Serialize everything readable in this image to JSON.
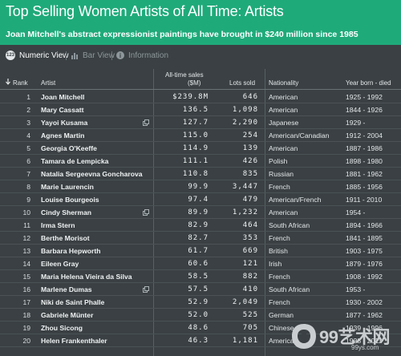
{
  "header": {
    "title": "Top Selling Women Artists of All Time: Artists",
    "subtitle": "Joan Mitchell's abstract expressionist paintings have brought in $240 million since 1985",
    "background_color": "#1faa7a"
  },
  "view_tabs": [
    {
      "label": "Numeric View",
      "icon": "numeric-view-icon",
      "active": true
    },
    {
      "label": "Bar View",
      "icon": "bar-chart-icon",
      "active": false
    },
    {
      "label": "Information",
      "icon": "info-icon",
      "active": false
    }
  ],
  "table": {
    "sort_icon": "sort-down-arrow-icon",
    "columns": {
      "rank": "Rank",
      "artist": "Artist",
      "sales_line1": "All-time sales",
      "sales_line2": "($M)",
      "lots": "Lots sold",
      "nationality": "Nationality",
      "years": "Year born - died"
    },
    "rows": [
      {
        "rank": "1",
        "artist": "Joan Mitchell",
        "sales": "$239.8M",
        "lots": "646",
        "nationality": "American",
        "years": "1925 - 1992",
        "link_icon": false
      },
      {
        "rank": "2",
        "artist": "Mary Cassatt",
        "sales": "136.5",
        "lots": "1,098",
        "nationality": "American",
        "years": "1844 - 1926",
        "link_icon": false
      },
      {
        "rank": "3",
        "artist": "Yayoi Kusama",
        "sales": "127.7",
        "lots": "2,290",
        "nationality": "Japanese",
        "years": "1929 -",
        "link_icon": true
      },
      {
        "rank": "4",
        "artist": "Agnes Martin",
        "sales": "115.0",
        "lots": "254",
        "nationality": "American/Canadian",
        "years": "1912 - 2004",
        "link_icon": false
      },
      {
        "rank": "5",
        "artist": "Georgia O'Keeffe",
        "sales": "114.9",
        "lots": "139",
        "nationality": "American",
        "years": "1887 - 1986",
        "link_icon": false
      },
      {
        "rank": "6",
        "artist": "Tamara de Lempicka",
        "sales": "111.1",
        "lots": "426",
        "nationality": "Polish",
        "years": "1898 - 1980",
        "link_icon": false
      },
      {
        "rank": "7",
        "artist": "Natalia Sergeevna Goncharova",
        "sales": "110.8",
        "lots": "835",
        "nationality": "Russian",
        "years": "1881 - 1962",
        "link_icon": false
      },
      {
        "rank": "8",
        "artist": "Marie Laurencin",
        "sales": "99.9",
        "lots": "3,447",
        "nationality": "French",
        "years": "1885 - 1956",
        "link_icon": false
      },
      {
        "rank": "9",
        "artist": "Louise Bourgeois",
        "sales": "97.4",
        "lots": "479",
        "nationality": "American/French",
        "years": "1911 - 2010",
        "link_icon": false
      },
      {
        "rank": "10",
        "artist": "Cindy Sherman",
        "sales": "89.9",
        "lots": "1,232",
        "nationality": "American",
        "years": "1954 -",
        "link_icon": true
      },
      {
        "rank": "11",
        "artist": "Irma Stern",
        "sales": "82.9",
        "lots": "464",
        "nationality": "South African",
        "years": "1894 - 1966",
        "link_icon": false
      },
      {
        "rank": "12",
        "artist": "Berthe Morisot",
        "sales": "82.7",
        "lots": "353",
        "nationality": "French",
        "years": "1841 - 1895",
        "link_icon": false
      },
      {
        "rank": "13",
        "artist": "Barbara Hepworth",
        "sales": "61.7",
        "lots": "669",
        "nationality": "British",
        "years": "1903 - 1975",
        "link_icon": false
      },
      {
        "rank": "14",
        "artist": "Eileen Gray",
        "sales": "60.6",
        "lots": "121",
        "nationality": "Irish",
        "years": "1879 - 1976",
        "link_icon": false
      },
      {
        "rank": "15",
        "artist": "Maria Helena Vieira da Silva",
        "sales": "58.5",
        "lots": "882",
        "nationality": "French",
        "years": "1908 - 1992",
        "link_icon": false
      },
      {
        "rank": "16",
        "artist": "Marlene Dumas",
        "sales": "57.5",
        "lots": "410",
        "nationality": "South African",
        "years": "1953 -",
        "link_icon": true
      },
      {
        "rank": "17",
        "artist": "Niki de Saint Phalle",
        "sales": "52.9",
        "lots": "2,049",
        "nationality": "French",
        "years": "1930 - 2002",
        "link_icon": false
      },
      {
        "rank": "18",
        "artist": "Gabriele Münter",
        "sales": "52.0",
        "lots": "525",
        "nationality": "German",
        "years": "1877 - 1962",
        "link_icon": false
      },
      {
        "rank": "19",
        "artist": "Zhou Sicong",
        "sales": "48.6",
        "lots": "705",
        "nationality": "Chinese",
        "years": "1939 - 1996",
        "link_icon": false
      },
      {
        "rank": "20",
        "artist": "Helen Frankenthaler",
        "sales": "46.3",
        "lots": "1,181",
        "nationality": "American",
        "years": "1928 - 2011",
        "link_icon": false
      }
    ]
  },
  "watermark": {
    "text": "99艺术网",
    "url": "99ys.com"
  }
}
